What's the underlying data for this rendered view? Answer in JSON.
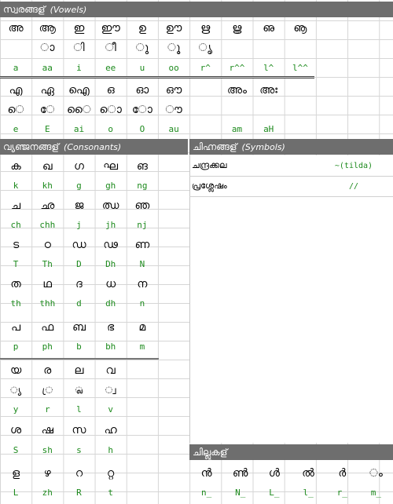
{
  "vowels": {
    "header": "സ്വരങ്ങള്",
    "header_en": "(Vowels)",
    "row1_letters": [
      "അ",
      "ആ",
      "ഇ",
      "ഈ",
      "ഉ",
      "ഊ",
      "ഋ",
      "ൠ",
      "ഌ",
      "ൡ"
    ],
    "row1_signs": [
      "",
      "ാ",
      "ി",
      "ീ",
      "ു",
      "ൂ",
      "ൃ",
      "",
      "",
      ""
    ],
    "row1_translit": [
      "a",
      "aa",
      "i",
      "ee",
      "u",
      "oo",
      "r^",
      "r^^",
      "l^",
      "l^^"
    ],
    "row2_letters": [
      "എ",
      "ഏ",
      "ഐ",
      "ഒ",
      "ഓ",
      "ഔ",
      "",
      "അം",
      "അഃ",
      ""
    ],
    "row2_signs": [
      "െ",
      "േ",
      "ൈ",
      "ൊ",
      "ോ",
      "ൗ",
      "",
      "",
      "",
      ""
    ],
    "row2_translit": [
      "e",
      "E",
      "ai",
      "o",
      "O",
      "au",
      "",
      "am",
      "aH",
      ""
    ]
  },
  "consonants": {
    "header": "വ്യഞ്ജനങ്ങള്",
    "header_en": "(Consonants)",
    "rows": [
      {
        "letters": [
          "ക",
          "ഖ",
          "ഗ",
          "ഘ",
          "ങ"
        ],
        "translit": [
          "k",
          "kh",
          "g",
          "gh",
          "ng"
        ]
      },
      {
        "letters": [
          "ച",
          "ഛ",
          "ജ",
          "ഝ",
          "ഞ"
        ],
        "translit": [
          "ch",
          "chh",
          "j",
          "jh",
          "nj"
        ]
      },
      {
        "letters": [
          "ട",
          "ഠ",
          "ഡ",
          "ഢ",
          "ണ"
        ],
        "translit": [
          "T",
          "Th",
          "D",
          "Dh",
          "N"
        ]
      },
      {
        "letters": [
          "ത",
          "ഥ",
          "ദ",
          "ധ",
          "ന"
        ],
        "translit": [
          "th",
          "thh",
          "d",
          "dh",
          "n"
        ]
      },
      {
        "letters": [
          "പ",
          "ഫ",
          "ബ",
          "ഭ",
          "മ"
        ],
        "translit": [
          "p",
          "ph",
          "b",
          "bh",
          "m"
        ]
      }
    ],
    "semivowels": {
      "letters": [
        "യ",
        "ര",
        "ല",
        "വ"
      ],
      "signs": [
        "്യ",
        "്ര",
        "്ല",
        "്വ"
      ],
      "translit": [
        "y",
        "r",
        "l",
        "v"
      ]
    },
    "sibilants": {
      "letters": [
        "ശ",
        "ഷ",
        "സ",
        "ഹ"
      ],
      "translit": [
        "S",
        "sh",
        "s",
        "h"
      ]
    },
    "others": {
      "letters": [
        "ള",
        "ഴ",
        "റ",
        "റ്റ"
      ],
      "translit": [
        "L",
        "zh",
        "R",
        "t"
      ]
    }
  },
  "symbols": {
    "header": "ചിഹ്നങ്ങള്",
    "header_en": "(Symbols)",
    "items": [
      {
        "name": "ചന്ദ്രക്കല",
        "key": "~(tilda)"
      },
      {
        "name": "പ്രശ്ലേഷം",
        "key": "//"
      }
    ]
  },
  "chillu": {
    "header": "ചില്ലുകള്",
    "letters": [
      "ൻ",
      "ൺ",
      "ൾ",
      "ൽ",
      "ർ",
      "ം"
    ],
    "translit": [
      "n_",
      "N_",
      "L_",
      "l_",
      "r_",
      "m_"
    ]
  }
}
